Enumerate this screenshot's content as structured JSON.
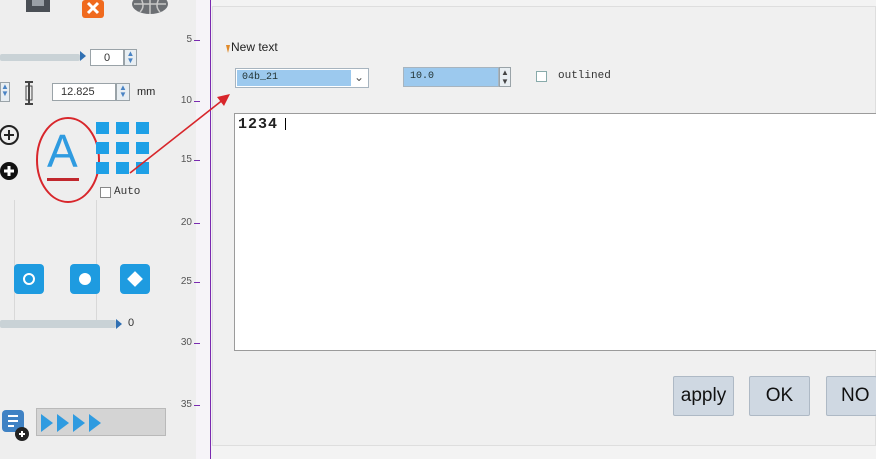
{
  "toolbar": {
    "save_icon": "save-icon",
    "delete_icon": "delete-icon",
    "globe_icon": "globe-icon"
  },
  "left_panel": {
    "slider1_value": "0",
    "height_value": "12.825",
    "height_unit": "mm",
    "auto_label": "Auto",
    "slider2_value": "0",
    "text_tool_letter": "A"
  },
  "ruler": {
    "labels": [
      "5",
      "10",
      "15",
      "20",
      "25",
      "30",
      "35"
    ]
  },
  "dialog": {
    "title": "New text",
    "font_select": "04b_21",
    "font_size": "10.0",
    "outlined_label": "outlined",
    "text_content": "1234",
    "buttons": {
      "apply": "apply",
      "ok": "OK",
      "no": "NO"
    }
  },
  "colors": {
    "accent_blue": "#1ea0e6",
    "annotation_red": "#d8262b",
    "ruler_purple": "#7a2bb0",
    "selection_blue": "#9cc9ee"
  }
}
